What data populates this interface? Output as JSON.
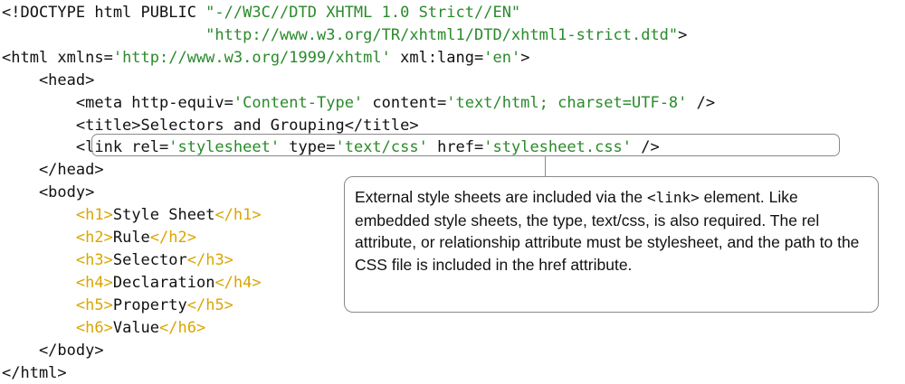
{
  "code": {
    "lines": [
      [
        {
          "t": "<!DOCTYPE html PUBLIC ",
          "c": "k"
        },
        {
          "t": "\"-//W3C//DTD XHTML 1.0 Strict//EN\"",
          "c": "g"
        }
      ],
      [
        {
          "t": "                      ",
          "c": "k"
        },
        {
          "t": "\"http://www.w3.org/TR/xhtml1/DTD/xhtml1-strict.dtd\"",
          "c": "g"
        },
        {
          "t": ">",
          "c": "k"
        }
      ],
      [
        {
          "t": "<html xmlns=",
          "c": "k"
        },
        {
          "t": "'http://www.w3.org/1999/xhtml'",
          "c": "g"
        },
        {
          "t": " xml:lang=",
          "c": "k"
        },
        {
          "t": "'en'",
          "c": "g"
        },
        {
          "t": ">",
          "c": "k"
        }
      ],
      [
        {
          "t": "    <head>",
          "c": "k"
        }
      ],
      [
        {
          "t": "        <meta http-equiv=",
          "c": "k"
        },
        {
          "t": "'Content-Type'",
          "c": "g"
        },
        {
          "t": " content=",
          "c": "k"
        },
        {
          "t": "'text/html; charset=UTF-8'",
          "c": "g"
        },
        {
          "t": " />",
          "c": "k"
        }
      ],
      [
        {
          "t": "        <title>Selectors and Grouping</title>",
          "c": "k"
        }
      ],
      [
        {
          "t": "        <link rel=",
          "c": "k"
        },
        {
          "t": "'stylesheet'",
          "c": "g"
        },
        {
          "t": " type=",
          "c": "k"
        },
        {
          "t": "'text/css'",
          "c": "g"
        },
        {
          "t": " href=",
          "c": "k"
        },
        {
          "t": "'stylesheet.css'",
          "c": "g"
        },
        {
          "t": " />",
          "c": "k"
        }
      ],
      [
        {
          "t": "    </head>",
          "c": "k"
        }
      ],
      [
        {
          "t": "    <body>",
          "c": "k"
        }
      ],
      [
        {
          "t": "        ",
          "c": "k"
        },
        {
          "t": "<h1>",
          "c": "y"
        },
        {
          "t": "Style Sheet",
          "c": "k"
        },
        {
          "t": "</h1>",
          "c": "y"
        }
      ],
      [
        {
          "t": "        ",
          "c": "k"
        },
        {
          "t": "<h2>",
          "c": "y"
        },
        {
          "t": "Rule",
          "c": "k"
        },
        {
          "t": "</h2>",
          "c": "y"
        }
      ],
      [
        {
          "t": "        ",
          "c": "k"
        },
        {
          "t": "<h3>",
          "c": "y"
        },
        {
          "t": "Selector",
          "c": "k"
        },
        {
          "t": "</h3>",
          "c": "y"
        }
      ],
      [
        {
          "t": "        ",
          "c": "k"
        },
        {
          "t": "<h4>",
          "c": "y"
        },
        {
          "t": "Declaration",
          "c": "k"
        },
        {
          "t": "</h4>",
          "c": "y"
        }
      ],
      [
        {
          "t": "        ",
          "c": "k"
        },
        {
          "t": "<h5>",
          "c": "y"
        },
        {
          "t": "Property",
          "c": "k"
        },
        {
          "t": "</h5>",
          "c": "y"
        }
      ],
      [
        {
          "t": "        ",
          "c": "k"
        },
        {
          "t": "<h6>",
          "c": "y"
        },
        {
          "t": "Value",
          "c": "k"
        },
        {
          "t": "</h6>",
          "c": "y"
        }
      ],
      [
        {
          "t": "    </body>",
          "c": "k"
        }
      ],
      [
        {
          "t": "</html>",
          "c": "k"
        }
      ]
    ]
  },
  "callout": {
    "text_before": "External style sheets are included via the ",
    "code_term": "<link>",
    "text_after": " element.  Like embedded style sheets, the type, text/css, is also required.  The rel attribute, or relationship attribute must be stylesheet, and the path to the CSS file is included in the href attribute."
  },
  "colors": {
    "string": "#2a8a2a",
    "heading_tag": "#d9a600",
    "text": "#111111",
    "border": "#8a8a8a"
  }
}
